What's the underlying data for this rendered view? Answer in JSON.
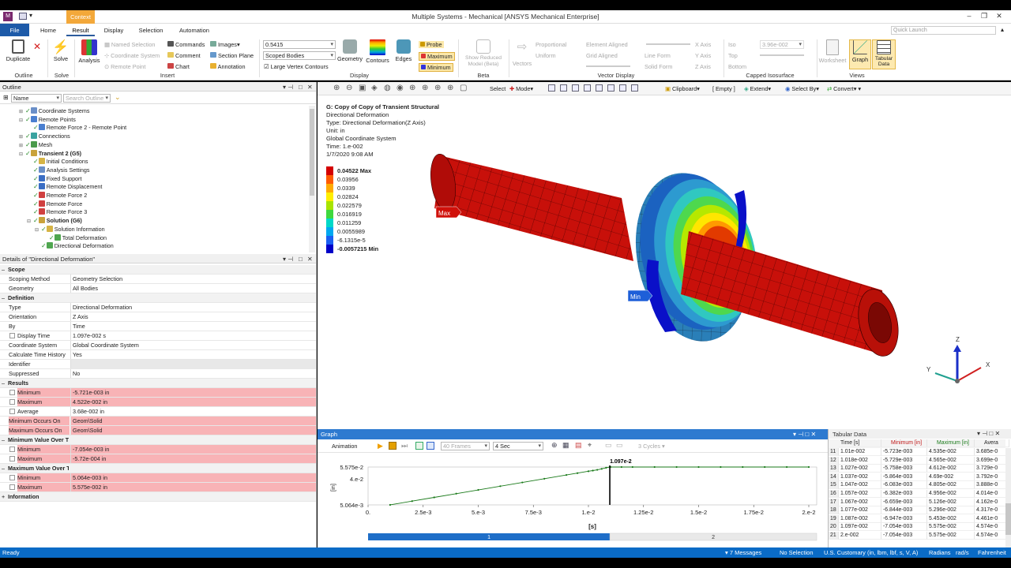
{
  "window": {
    "title": "Multiple Systems - Mechanical [ANSYS Mechanical Enterprise]",
    "context_tab": "Context"
  },
  "tabs": {
    "file": "File",
    "items": [
      "Home",
      "Result",
      "Display",
      "Selection",
      "Automation"
    ],
    "active": "Result"
  },
  "quick_launch": {
    "placeholder": "Quick Launch"
  },
  "ribbon": {
    "duplicate": "Duplicate",
    "outline_group": "Outline",
    "solve": "Solve",
    "solve_group": "Solve",
    "analysis": "Analysis",
    "named_selection": "Named Selection",
    "coordinate_system": "Coordinate System",
    "remote_point": "Remote Point",
    "commands": "Commands",
    "comment": "Comment",
    "chart": "Chart",
    "images": "Images",
    "section_plane": "Section Plane",
    "annotation": "Annotation",
    "insert_group": "Insert",
    "scale_value": "0.5415",
    "scoped_bodies": "Scoped Bodies",
    "large_vertex": "Large Vertex Contours",
    "geometry": "Geometry",
    "contours": "Contours",
    "edges": "Edges",
    "display_group": "Display",
    "probe": "Probe",
    "maximum": "Maximum",
    "minimum": "Minimum",
    "show_reduced": "Show Reduced Model (Beta)",
    "beta_group": "Beta",
    "vectors": "Vectors",
    "proportional": "Proportional",
    "uniform": "Uniform",
    "element_aligned": "Element Aligned",
    "grid_aligned": "Grid Aligned",
    "line_form": "Line Form",
    "solid_form": "Solid Form",
    "x_axis": "X Axis",
    "y_axis": "Y Axis",
    "z_axis": "Z Axis",
    "vector_group": "Vector Display",
    "iso": "Iso",
    "top": "Top",
    "bottom": "Bottom",
    "iso_value": "3.96e-002",
    "capped_group": "Capped Isosurface",
    "worksheet": "Worksheet",
    "graph": "Graph",
    "tabular": "Tabular Data",
    "views_group": "Views"
  },
  "outline": {
    "title": "Outline",
    "filter_name": "Name",
    "search_placeholder": "Search Outline",
    "items": [
      {
        "label": "Coordinate Systems",
        "indent": 2,
        "color": "#6a8fc8"
      },
      {
        "label": "Remote Points",
        "indent": 2,
        "color": "#4a7fd0"
      },
      {
        "label": "Remote Force 2 - Remote Point",
        "indent": 3,
        "color": "#4a7fd0"
      },
      {
        "label": "Connections",
        "indent": 2,
        "color": "#3aa3a0"
      },
      {
        "label": "Mesh",
        "indent": 2,
        "color": "#4a9a4a"
      },
      {
        "label": "Transient 2 (G5)",
        "indent": 2,
        "color": "#c9a23b",
        "bold": true
      },
      {
        "label": "Initial Conditions",
        "indent": 3,
        "color": "#d6b445"
      },
      {
        "label": "Analysis Settings",
        "indent": 3,
        "color": "#6a8fc8"
      },
      {
        "label": "Fixed Support",
        "indent": 3,
        "color": "#3b6ec4"
      },
      {
        "label": "Remote Displacement",
        "indent": 3,
        "color": "#3b6ec4"
      },
      {
        "label": "Remote Force 2",
        "indent": 3,
        "color": "#d04040"
      },
      {
        "label": "Remote Force",
        "indent": 3,
        "color": "#d04040"
      },
      {
        "label": "Remote Force 3",
        "indent": 3,
        "color": "#d04040"
      },
      {
        "label": "Solution (G6)",
        "indent": 3,
        "color": "#c9a23b",
        "bold": true
      },
      {
        "label": "Solution Information",
        "indent": 4,
        "color": "#d6b445"
      },
      {
        "label": "Total Deformation",
        "indent": 5,
        "color": "#4fa64f"
      },
      {
        "label": "Directional Deformation",
        "indent": 4,
        "color": "#4fa64f"
      }
    ]
  },
  "details": {
    "title": "Details of \"Directional Deformation\"",
    "rows": [
      {
        "k": "Scope",
        "type": "sec"
      },
      {
        "k": "Scoping Method",
        "v": "Geometry Selection"
      },
      {
        "k": "Geometry",
        "v": "All Bodies"
      },
      {
        "k": "Definition",
        "type": "sec"
      },
      {
        "k": "Type",
        "v": "Directional Deformation"
      },
      {
        "k": "Orientation",
        "v": "Z Axis"
      },
      {
        "k": "By",
        "v": "Time"
      },
      {
        "k": "Display Time",
        "v": "1.097e-002 s",
        "cb": true
      },
      {
        "k": "Coordinate System",
        "v": "Global Coordinate System"
      },
      {
        "k": "Calculate Time History",
        "v": "Yes"
      },
      {
        "k": "Identifier",
        "v": ""
      },
      {
        "k": "Suppressed",
        "v": "No"
      },
      {
        "k": "Results",
        "type": "sec"
      },
      {
        "k": "Minimum",
        "v": "-5.721e-003 in",
        "cb": true,
        "pink": true
      },
      {
        "k": "Maximum",
        "v": "4.522e-002 in",
        "cb": true,
        "pink": true
      },
      {
        "k": "Average",
        "v": "3.68e-002 in",
        "cb": true
      },
      {
        "k": "Minimum Occurs On",
        "v": "Geom\\Solid",
        "pink": true
      },
      {
        "k": "Maximum Occurs On",
        "v": "Geom\\Solid",
        "pink": true
      },
      {
        "k": "Minimum Value Over Time",
        "type": "sec"
      },
      {
        "k": "Minimum",
        "v": "-7.054e-003 in",
        "cb": true,
        "pink": true
      },
      {
        "k": "Maximum",
        "v": "-5.72e-004 in",
        "cb": true,
        "pink": true
      },
      {
        "k": "Maximum Value Over Time",
        "type": "sec"
      },
      {
        "k": "Minimum",
        "v": "5.064e-003 in",
        "cb": true,
        "pink": true
      },
      {
        "k": "Maximum",
        "v": "5.575e-002 in",
        "cb": true,
        "pink": true
      },
      {
        "k": "Information",
        "type": "sec",
        "collapsed": true
      }
    ]
  },
  "viewer": {
    "toolbar": {
      "select": "Select",
      "mode": "Mode",
      "clipboard": "Clipboard",
      "empty": "[ Empty ]",
      "extend": "Extend",
      "select_by": "Select By",
      "convert": "Convert"
    },
    "info": [
      "G: Copy of Copy of Transient Structural",
      "Directional Deformation",
      "Type: Directional Deformation(Z Axis)",
      "Unit: in",
      "Global Coordinate System",
      "Time: 1.e-002",
      "1/7/2020 9:08 AM"
    ],
    "legend": [
      {
        "label": "0.04522 Max",
        "color": "#d40000",
        "bold": true
      },
      {
        "label": "0.03956",
        "color": "#ff5a00"
      },
      {
        "label": "0.0339",
        "color": "#ffaa00"
      },
      {
        "label": "0.02824",
        "color": "#ffee00"
      },
      {
        "label": "0.022579",
        "color": "#a8e400"
      },
      {
        "label": "0.016919",
        "color": "#3ed83e"
      },
      {
        "label": "0.011259",
        "color": "#00d8c8"
      },
      {
        "label": "0.0055989",
        "color": "#00a8f0"
      },
      {
        "label": "-6.1315e-5",
        "color": "#1a5ff2"
      },
      {
        "label": "-0.0057215 Min",
        "color": "#0000c8",
        "bold": true
      }
    ],
    "max_tag": "Max",
    "min_tag": "Min",
    "axes": {
      "x": "X",
      "y": "Y",
      "z": "Z"
    }
  },
  "graph": {
    "title": "Graph",
    "animation": "Animation",
    "frames": "40 Frames",
    "duration": "4 Sec",
    "cycles": "3 Cycles",
    "ylabel": "[in]",
    "xlabel": "[s]",
    "cursor_label": "1.097e-2",
    "step1": "1",
    "step2": "2"
  },
  "chart_data": {
    "type": "line",
    "title": "",
    "xlabel": "[s]",
    "ylabel": "[in]",
    "xlim": [
      0,
      0.021
    ],
    "ylim": [
      0.005064,
      0.05575
    ],
    "x_ticks": [
      "0.",
      "2.5e-3",
      "5.e-3",
      "7.5e-3",
      "1.e-2",
      "1.25e-2",
      "1.5e-2",
      "1.75e-2",
      "2.e-2"
    ],
    "y_ticks": [
      "5.064e-3",
      "4.e-2",
      "5.575e-2"
    ],
    "series": [
      {
        "x": [
          0.001,
          0.002,
          0.003,
          0.004,
          0.005,
          0.006,
          0.007,
          0.008,
          0.009,
          0.0095,
          0.01,
          0.0102,
          0.0104,
          0.0106,
          0.0108,
          0.01097,
          0.011,
          0.0115,
          0.012,
          0.013,
          0.014,
          0.015,
          0.016,
          0.017,
          0.018,
          0.019,
          0.02
        ],
        "values": [
          0.0051,
          0.0101,
          0.0151,
          0.0201,
          0.0251,
          0.0301,
          0.0351,
          0.0401,
          0.0451,
          0.0476,
          0.0501,
          0.051,
          0.052,
          0.0533,
          0.0548,
          0.05575,
          0.05575,
          0.05575,
          0.05575,
          0.05575,
          0.05575,
          0.05575,
          0.05575,
          0.05575,
          0.05575,
          0.05575,
          0.05575
        ]
      }
    ]
  },
  "tabular": {
    "title": "Tabular Data",
    "headers": [
      "Time [s]",
      "Minimum [in]",
      "Maximum [in]",
      "Avera"
    ],
    "rows": [
      [
        "11",
        "1.01e-002",
        "-5.723e-003",
        "4.535e-002",
        "3.685e-0"
      ],
      [
        "12",
        "1.018e-002",
        "-5.729e-003",
        "4.565e-002",
        "3.699e-0"
      ],
      [
        "13",
        "1.027e-002",
        "-5.758e-003",
        "4.612e-002",
        "3.729e-0"
      ],
      [
        "14",
        "1.037e-002",
        "-5.864e-003",
        "4.69e-002",
        "3.792e-0"
      ],
      [
        "15",
        "1.047e-002",
        "-6.083e-003",
        "4.805e-002",
        "3.888e-0"
      ],
      [
        "16",
        "1.057e-002",
        "-6.382e-003",
        "4.956e-002",
        "4.014e-0"
      ],
      [
        "17",
        "1.067e-002",
        "-6.659e-003",
        "5.126e-002",
        "4.162e-0"
      ],
      [
        "18",
        "1.077e-002",
        "-6.844e-003",
        "5.296e-002",
        "4.317e-0"
      ],
      [
        "19",
        "1.087e-002",
        "-6.947e-003",
        "5.453e-002",
        "4.461e-0"
      ],
      [
        "20",
        "1.097e-002",
        "-7.054e-003",
        "5.575e-002",
        "4.574e-0"
      ],
      [
        "21",
        "2.e-002",
        "-7.054e-003",
        "5.575e-002",
        "4.574e-0"
      ]
    ]
  },
  "status": {
    "ready": "Ready",
    "messages": "7 Messages",
    "selection": "No Selection",
    "units": "U.S. Customary (in, lbm, lbf, s, V, A)",
    "angle": "Radians",
    "rate": "rad/s",
    "temp": "Fahrenheit"
  },
  "colors": {
    "accent": "#2d7ad0",
    "file_tab": "#1d5aa8",
    "status": "#0a6bc6",
    "highlight": "#f8b3b6"
  }
}
